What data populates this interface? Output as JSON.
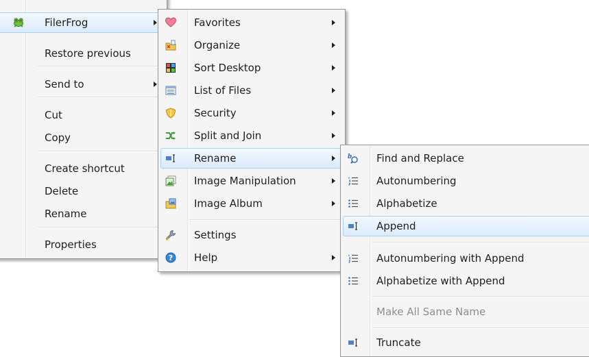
{
  "context_menu": {
    "items": [
      {
        "label": "FilerFrog"
      },
      {
        "label": "Restore previous"
      },
      {
        "label": "Send to"
      },
      {
        "label": "Cut"
      },
      {
        "label": "Copy"
      },
      {
        "label": "Create shortcut"
      },
      {
        "label": "Delete"
      },
      {
        "label": "Rename"
      },
      {
        "label": "Properties"
      }
    ]
  },
  "filerfrog_menu": {
    "items": [
      {
        "label": "Favorites",
        "icon": "heart-icon"
      },
      {
        "label": "Organize",
        "icon": "organize-icon"
      },
      {
        "label": "Sort Desktop",
        "icon": "sort-desktop-icon"
      },
      {
        "label": "List of Files",
        "icon": "list-icon"
      },
      {
        "label": "Security",
        "icon": "shield-icon"
      },
      {
        "label": "Split and Join",
        "icon": "split-join-icon"
      },
      {
        "label": "Rename",
        "icon": "rename-icon"
      },
      {
        "label": "Image Manipulation",
        "icon": "image-icon"
      },
      {
        "label": "Image Album",
        "icon": "album-icon"
      },
      {
        "label": "Settings",
        "icon": "wrench-icon"
      },
      {
        "label": "Help",
        "icon": "help-icon"
      }
    ]
  },
  "rename_menu": {
    "items": [
      {
        "label": "Find and Replace",
        "icon": "find-replace-icon"
      },
      {
        "label": "Autonumbering",
        "icon": "numbered-list-icon"
      },
      {
        "label": "Alphabetize",
        "icon": "bulleted-list-icon"
      },
      {
        "label": "Append",
        "icon": "text-cursor-icon"
      },
      {
        "label": "Autonumbering with Append",
        "icon": "numbered-list-icon"
      },
      {
        "label": "Alphabetize with Append",
        "icon": "bulleted-list-icon"
      },
      {
        "label": "Make All Same Name"
      },
      {
        "label": "Truncate",
        "icon": "text-cursor-icon"
      }
    ]
  },
  "colors": {
    "highlight_border": "#a8d0f5",
    "menu_background": "#f5f5f5",
    "disabled_text": "#8d8d8d"
  }
}
